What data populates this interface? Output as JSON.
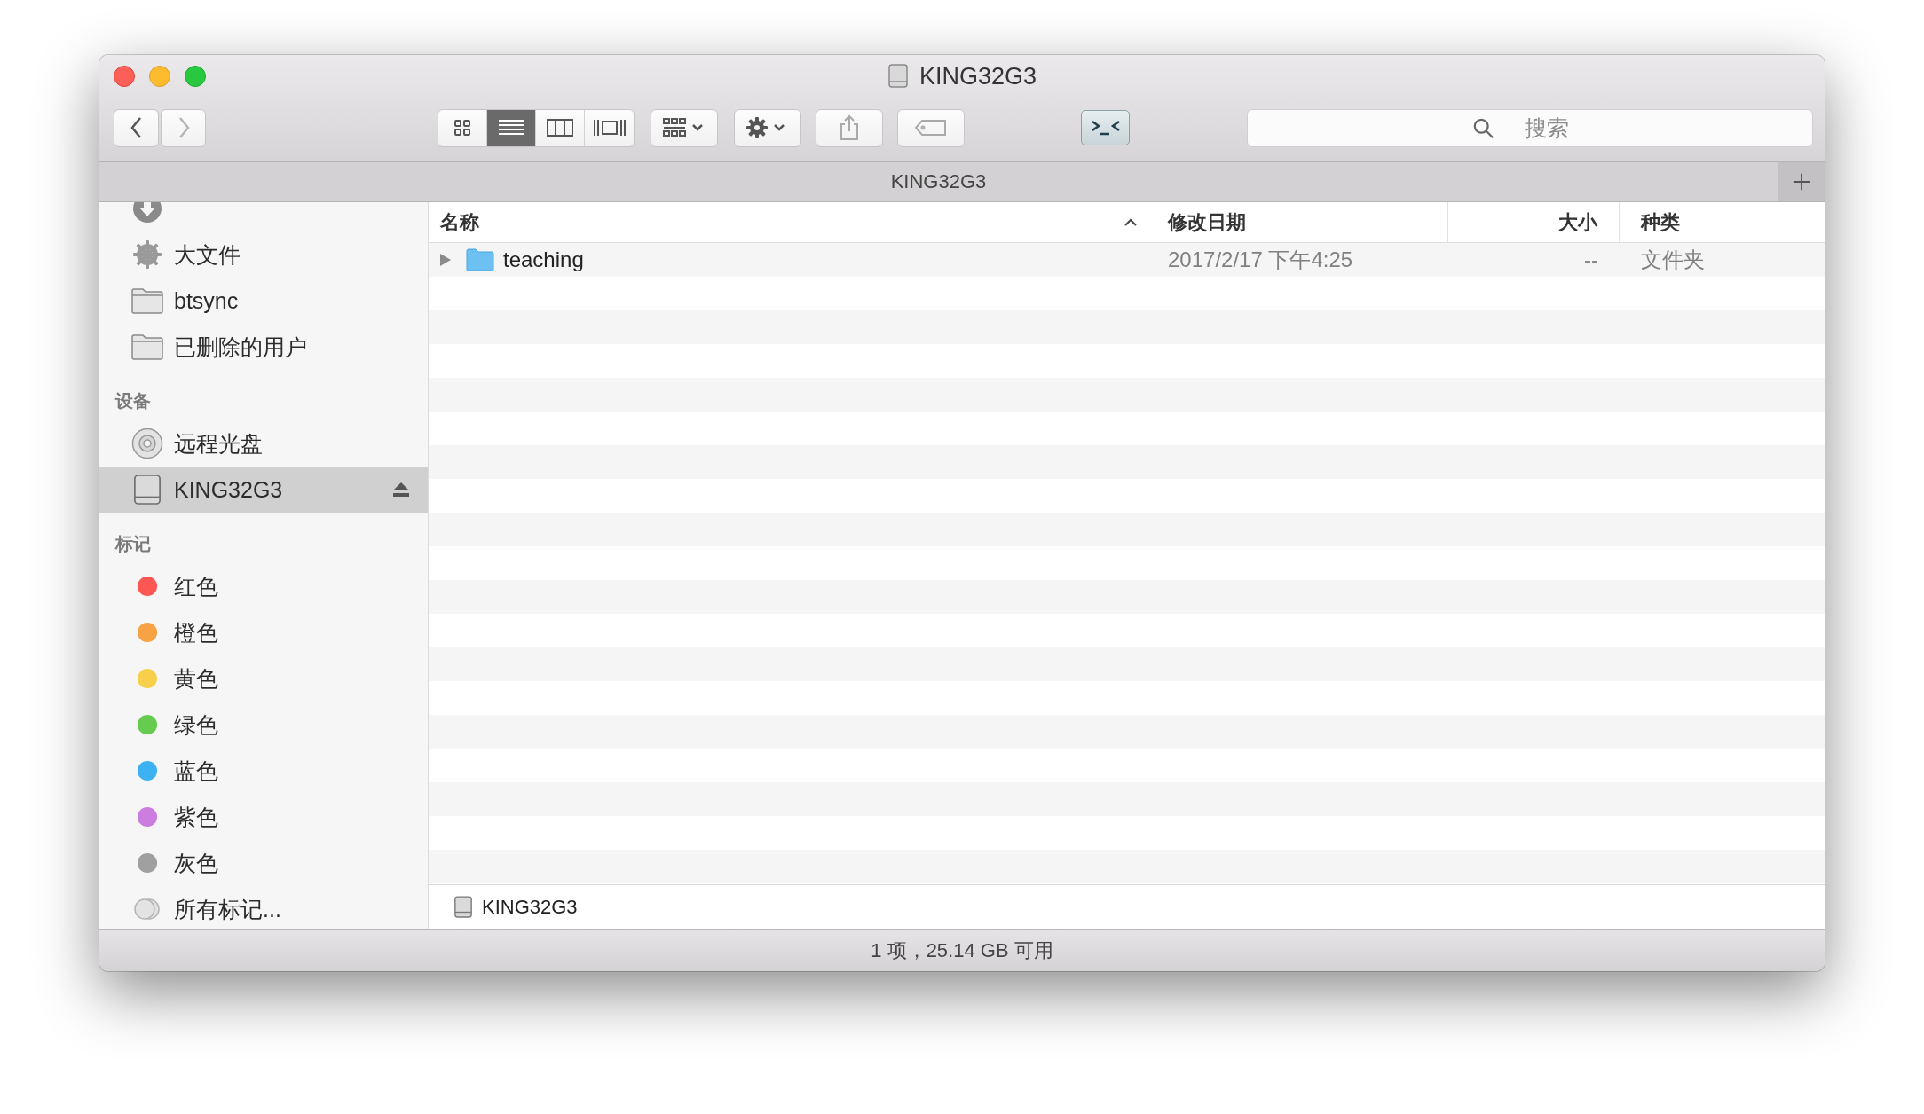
{
  "window": {
    "title": "KING32G3"
  },
  "toolbar": {
    "navigation": [
      {
        "kind": "back",
        "disabled": false
      },
      {
        "kind": "forward",
        "disabled": true
      }
    ],
    "view_modes": [
      {
        "kind": "icons",
        "selected": false
      },
      {
        "kind": "list",
        "selected": true
      },
      {
        "kind": "columns",
        "selected": false
      },
      {
        "kind": "cover_flow",
        "selected": false
      }
    ],
    "search": {
      "placeholder": "搜索"
    }
  },
  "tabs": [
    {
      "label": "KING32G3",
      "selected": true
    }
  ],
  "sidebar": {
    "sections": [
      {
        "items": [
          {
            "kind": "download",
            "selected": false
          },
          {
            "label": "大文件",
            "kind": "gear",
            "selected": false
          },
          {
            "label": "btsync",
            "kind": "folder",
            "selected": false
          },
          {
            "label": "已删除的用户",
            "kind": "folder",
            "selected": false
          }
        ]
      },
      {
        "heading": "设备",
        "items": [
          {
            "label": "远程光盘",
            "kind": "disc",
            "selected": false
          },
          {
            "label": "KING32G3",
            "kind": "drive",
            "selected": true,
            "eject": true
          }
        ]
      },
      {
        "heading": "标记",
        "items": [
          {
            "label": "红色",
            "kind": "tag",
            "selected": false,
            "color": "#fc5753"
          },
          {
            "label": "橙色",
            "kind": "tag",
            "selected": false,
            "color": "#f6a245"
          },
          {
            "label": "黄色",
            "kind": "tag",
            "selected": false,
            "color": "#f7cf4a"
          },
          {
            "label": "绿色",
            "kind": "tag",
            "selected": false,
            "color": "#66cc4f"
          },
          {
            "label": "蓝色",
            "kind": "tag",
            "selected": false,
            "color": "#3db2f3"
          },
          {
            "label": "紫色",
            "kind": "tag",
            "selected": false,
            "color": "#cb7ee0"
          },
          {
            "label": "灰色",
            "kind": "tag",
            "selected": false,
            "color": "#a0a0a0"
          },
          {
            "label": "所有标记...",
            "kind": "all_tags",
            "selected": false
          }
        ]
      }
    ]
  },
  "table": {
    "columns": [
      {
        "label": "名称",
        "sorted": true
      },
      {
        "label": "修改日期",
        "sorted": false
      },
      {
        "label": "大小",
        "sorted": false
      },
      {
        "label": "种类",
        "sorted": false
      }
    ],
    "rows": [
      {
        "name": "teaching",
        "modified": "2017/2/17 下午4:25",
        "size": "--",
        "kind_label": "文件夹",
        "expanded": false
      }
    ]
  },
  "path_bar": {
    "items": [
      "KING32G3"
    ]
  },
  "status_bar": "1 项，25.14 GB 可用"
}
